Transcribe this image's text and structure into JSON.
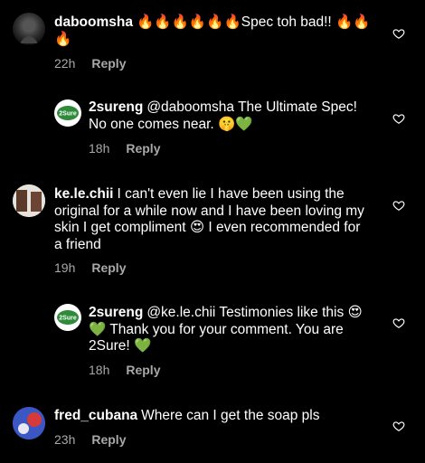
{
  "comments": [
    {
      "user": "daboomsha",
      "text": "🔥🔥🔥🔥🔥🔥Spec toh bad!! 🔥🔥🔥",
      "time": "22h",
      "reply_label": "Reply"
    },
    {
      "user": "2sureng",
      "text": "@daboomsha The Ultimate Spec! No one comes near. 🤫💚",
      "time": "18h",
      "reply_label": "Reply"
    },
    {
      "user": "ke.le.chii",
      "text": "I can't even lie I have been using the original for a while now and I have been loving my skin I get compliment 😍 I even recommended for a friend",
      "time": "19h",
      "reply_label": "Reply"
    },
    {
      "user": "2sureng",
      "text": "@ke.le.chii Testimonies like this 😍💚 Thank you for your comment. You are 2Sure! 💚",
      "time": "18h",
      "reply_label": "Reply"
    },
    {
      "user": "fred_cubana",
      "text": "Where can I get the soap pls",
      "time": "23h",
      "reply_label": "Reply"
    }
  ],
  "colors": {
    "background": "#000000",
    "text": "#ffffff",
    "meta": "#a8a8a8",
    "brand_green": "#2e8b3a"
  },
  "icons": {
    "like": "heart-outline-icon"
  }
}
